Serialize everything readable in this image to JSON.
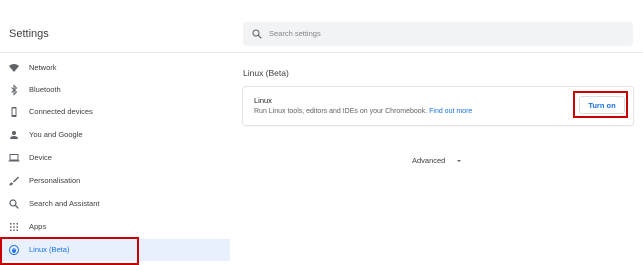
{
  "header": {
    "title": "Settings",
    "search_placeholder": "Search settings"
  },
  "sidebar": {
    "items": [
      {
        "label": "Network",
        "icon": "wifi-icon"
      },
      {
        "label": "Bluetooth",
        "icon": "bluetooth-icon"
      },
      {
        "label": "Connected devices",
        "icon": "phone-icon"
      },
      {
        "label": "You and Google",
        "icon": "person-icon"
      },
      {
        "label": "Device",
        "icon": "laptop-icon"
      },
      {
        "label": "Personalisation",
        "icon": "brush-icon"
      },
      {
        "label": "Search and Assistant",
        "icon": "search-icon"
      },
      {
        "label": "Apps",
        "icon": "apps-grid-icon"
      },
      {
        "label": "Linux (Beta)",
        "icon": "linux-penguin-icon",
        "selected": true
      }
    ]
  },
  "main": {
    "section_title": "Linux (Beta)",
    "card": {
      "title": "Linux",
      "description": "Run Linux tools, editors and IDEs on your Chromebook.",
      "link_text": "Find out more",
      "button_label": "Turn on"
    },
    "advanced_label": "Advanced"
  },
  "colors": {
    "accent": "#1a73e8",
    "selected_bg": "#e8f0fe",
    "highlight_annotation": "#cc0000"
  }
}
